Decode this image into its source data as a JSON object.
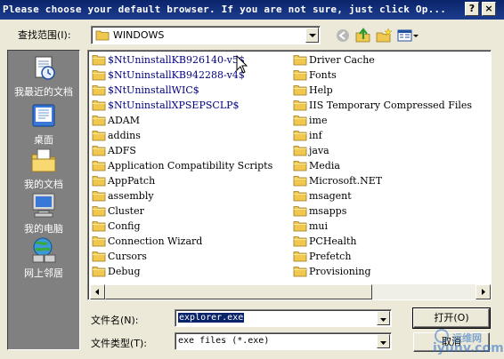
{
  "window": {
    "title": "Please choose your default browser. If you are not sure, just click Op...",
    "help_label": "?",
    "close_label": "×"
  },
  "lookin": {
    "label": "查找范围(I):",
    "value": "WINDOWS"
  },
  "places": [
    {
      "label": "我最近的文档",
      "icon": "recent-documents-icon"
    },
    {
      "label": "桌面",
      "icon": "desktop-icon"
    },
    {
      "label": "我的文档",
      "icon": "my-documents-icon"
    },
    {
      "label": "我的电脑",
      "icon": "my-computer-icon"
    },
    {
      "label": "网上邻居",
      "icon": "network-places-icon"
    }
  ],
  "files": {
    "col1": [
      "$NtUninstallKB926140-v5$",
      "$NtUninstallKB942288-v4$",
      "$NtUninstallWIC$",
      "$NtUninstallXPSEPSCLP$",
      "ADAM",
      "addins",
      "ADFS",
      "Application Compatibility Scripts",
      "AppPatch",
      "assembly",
      "Cluster",
      "Config",
      "Connection Wizard",
      "Cursors",
      "Debug"
    ],
    "col2": [
      "Driver Cache",
      "Fonts",
      "Help",
      "IIS Temporary Compressed Files",
      "ime",
      "inf",
      "java",
      "Media",
      "Microsoft.NET",
      "msagent",
      "msapps",
      "mui",
      "PCHealth",
      "Prefetch",
      "Provisioning"
    ]
  },
  "filename": {
    "label": "文件名(N):",
    "value": "explorer.exe"
  },
  "filetype": {
    "label": "文件类型(T):",
    "value": "exe files (*.exe)"
  },
  "buttons": {
    "open": "打开(O)",
    "cancel": "取消"
  },
  "watermark": {
    "cn": "运维网",
    "url": "iyunv.com"
  },
  "colors": {
    "titlebar": "#0a246a",
    "dialog_bg": "#ece9d8",
    "places_bg": "#808080",
    "folder": "#f0c850"
  }
}
